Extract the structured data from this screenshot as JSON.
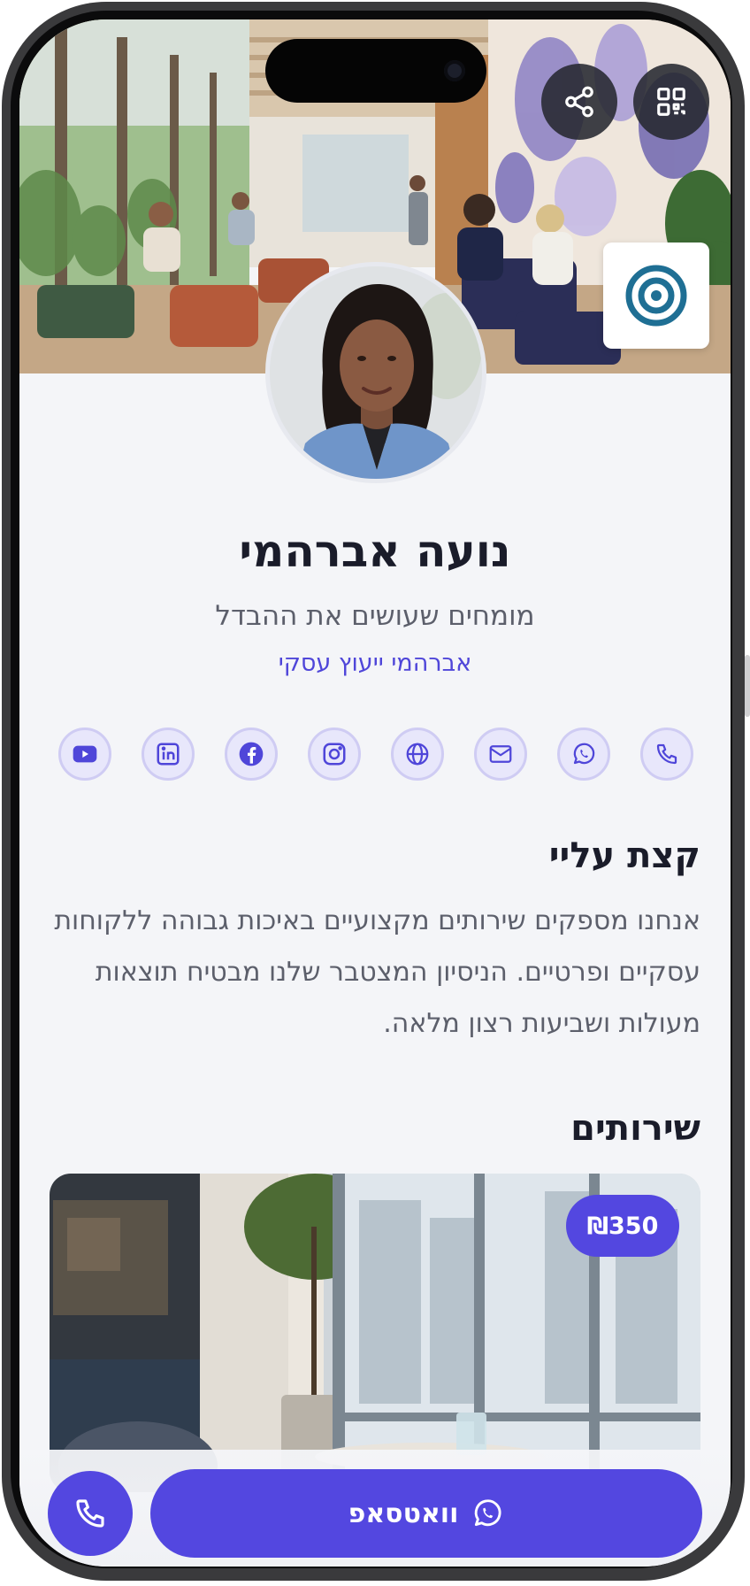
{
  "profile": {
    "name": "נועה אברהמי",
    "tagline": "מומחים שעושים את ההבדל",
    "company": "אברהמי ייעוץ עסקי"
  },
  "header_actions": {
    "share_icon": "share-icon",
    "qr_icon": "qr-code-icon"
  },
  "socials": [
    {
      "icon": "youtube-icon"
    },
    {
      "icon": "linkedin-icon"
    },
    {
      "icon": "facebook-icon"
    },
    {
      "icon": "instagram-icon"
    },
    {
      "icon": "globe-icon"
    },
    {
      "icon": "mail-icon"
    },
    {
      "icon": "whatsapp-icon"
    },
    {
      "icon": "phone-icon"
    }
  ],
  "about": {
    "title": "קצת עליי",
    "text": "אנחנו מספקים שירותים מקצועיים באיכות גבוהה ללקוחות עסקיים ופרטיים. הניסיון המצטבר שלנו מבטיח תוצאות מעולות ושביעות רצון מלאה."
  },
  "services": {
    "title": "שירותים",
    "items": [
      {
        "price": "₪350"
      }
    ]
  },
  "bottom_bar": {
    "whatsapp_label": "וואטסאפ"
  },
  "colors": {
    "accent": "#5347e0",
    "text_dark": "#1a1c2a",
    "text_muted": "#5c5f6b",
    "background": "#f4f5f8",
    "logo_blue": "#1f6f94"
  }
}
